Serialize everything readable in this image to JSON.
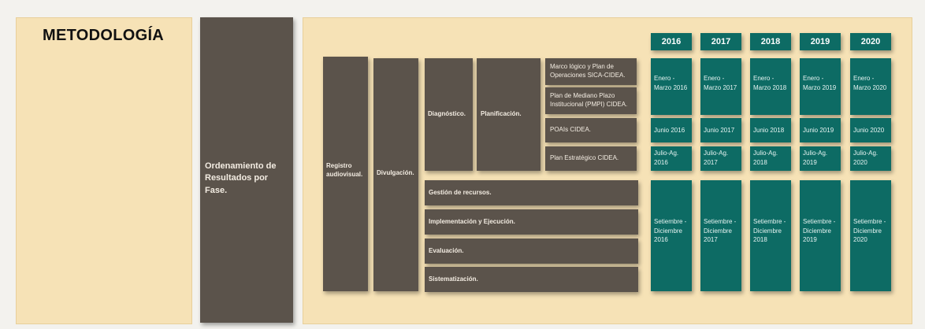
{
  "title": "METODOLOGÍA",
  "main_box": "Ordenamiento de Resultados por Fase.",
  "col1": "Registro audiovisual.",
  "col2": "Divulgación.",
  "diagnostico": "Diagnóstico.",
  "planificacion": "Planificación.",
  "plan_items": [
    "Marco lógico y Plan de Operaciones SICA-CIDEA.",
    "Plan de Mediano Plazo Institucional (PMPI) CIDEA.",
    "POAIs CIDEA.",
    "Plan Estratégico CIDEA."
  ],
  "rows": [
    "Gestión de recursos.",
    "Implementación y Ejecución.",
    "Evaluación.",
    "Sistematización."
  ],
  "years": [
    "2016",
    "2017",
    "2018",
    "2019",
    "2020"
  ],
  "periods": [
    [
      "Enero - Marzo 2016",
      "Junio 2016",
      "Julio-Ag. 2016",
      "Setiembre - Diciembre 2016"
    ],
    [
      "Enero - Marzo 2017",
      "Junio 2017",
      "Julio-Ag. 2017",
      "Setiembre - Diciembre 2017"
    ],
    [
      "Enero - Marzo 2018",
      "Junio 2018",
      "Julio-Ag. 2018",
      "Setiembre - Diciembre 2018"
    ],
    [
      "Enero - Marzo 2019",
      "Junio 2019",
      "Julio-Ag. 2019",
      "Setiembre - Diciembre 2019"
    ],
    [
      "Enero - Marzo 2020",
      "Junio 2020",
      "Julio-Ag. 2020",
      "Setiembre - Diciembre 2020"
    ]
  ],
  "colors": {
    "panel": "#f6e2b6",
    "box": "#5b534b",
    "teal": "#0d6b64"
  }
}
